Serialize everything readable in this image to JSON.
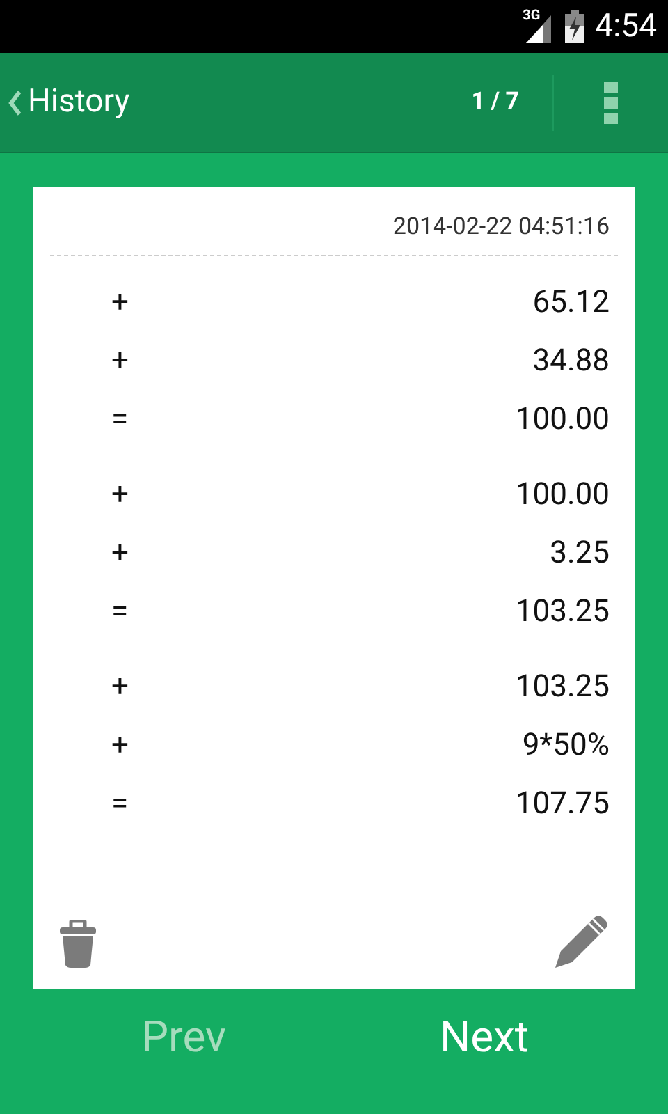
{
  "status_bar": {
    "network": "3G",
    "time": "4:54"
  },
  "app_bar": {
    "title": "History",
    "page": "1 / 7"
  },
  "record": {
    "timestamp": "2014-02-22 04:51:16",
    "groups": [
      [
        {
          "op": "+",
          "value": "65.12"
        },
        {
          "op": "+",
          "value": "34.88"
        },
        {
          "op": "=",
          "value": "100.00"
        }
      ],
      [
        {
          "op": "+",
          "value": "100.00"
        },
        {
          "op": "+",
          "value": "3.25"
        },
        {
          "op": "=",
          "value": "103.25"
        }
      ],
      [
        {
          "op": "+",
          "value": "103.25"
        },
        {
          "op": "+",
          "value": "9*50%"
        },
        {
          "op": "=",
          "value": "107.75"
        }
      ]
    ]
  },
  "nav": [
    {
      "label": "Prev",
      "disabled": true
    },
    {
      "label": "Next",
      "disabled": false
    }
  ]
}
